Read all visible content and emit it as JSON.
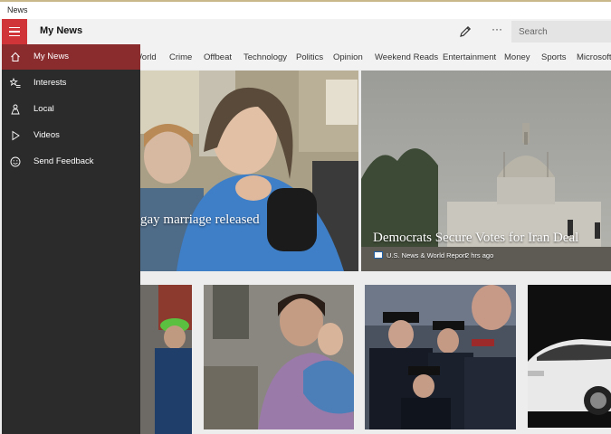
{
  "window": {
    "title": "News"
  },
  "header": {
    "app_title": "My News",
    "search_placeholder": "Search",
    "more_label": "···"
  },
  "categories": [
    "World",
    "Crime",
    "Offbeat",
    "Technology",
    "Politics",
    "Opinion",
    "Weekend Reads",
    "Entertainment",
    "Money",
    "Sports",
    "Microsoft"
  ],
  "nav": {
    "items": [
      {
        "label": "My News",
        "icon": "home-icon",
        "active": true
      },
      {
        "label": "Interests",
        "icon": "star-list-icon",
        "active": false
      },
      {
        "label": "Local",
        "icon": "local-pin-icon",
        "active": false
      },
      {
        "label": "Videos",
        "icon": "play-icon",
        "active": false
      },
      {
        "label": "Send Feedback",
        "icon": "smiley-icon",
        "active": false
      }
    ]
  },
  "stories": {
    "lead_left": {
      "headline": "gay marriage released"
    },
    "lead_right": {
      "headline": "Democrats Secure Votes for Iran Deal",
      "source": "U.S. News & World Report",
      "age": "2 hrs ago"
    }
  },
  "colors": {
    "accent": "#d13438",
    "nav_bg": "#2b2b2b",
    "nav_active": "#8a2b2e"
  }
}
